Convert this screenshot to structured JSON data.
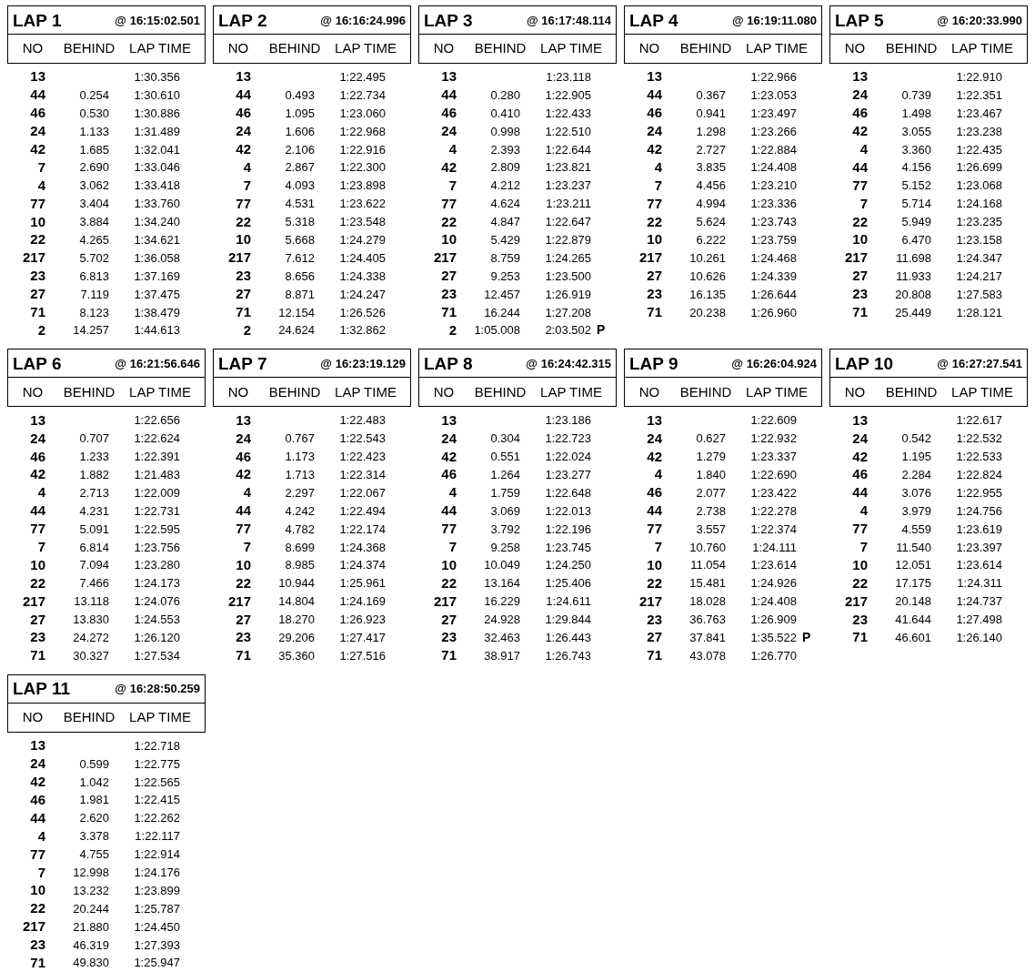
{
  "laps": [
    {
      "title": "LAP 1",
      "time": "@ 16:15:02.501",
      "columns": [
        "NO",
        "BEHIND",
        "LAP TIME"
      ],
      "rows": [
        {
          "no": "13",
          "lap_time": "1:30.356"
        },
        {
          "no": "44",
          "behind": "0.254",
          "lap_time": "1:30.610"
        },
        {
          "no": "46",
          "behind": "0.530",
          "lap_time": "1:30.886"
        },
        {
          "no": "24",
          "behind": "1.133",
          "lap_time": "1:31.489"
        },
        {
          "no": "42",
          "behind": "1.685",
          "lap_time": "1:32.041"
        },
        {
          "no": "7",
          "behind": "2.690",
          "lap_time": "1:33.046"
        },
        {
          "no": "4",
          "behind": "3.062",
          "lap_time": "1:33.418"
        },
        {
          "no": "77",
          "behind": "3.404",
          "lap_time": "1:33.760"
        },
        {
          "no": "10",
          "behind": "3.884",
          "lap_time": "1:34.240"
        },
        {
          "no": "22",
          "behind": "4.265",
          "lap_time": "1:34.621"
        },
        {
          "no": "217",
          "behind": "5.702",
          "lap_time": "1:36.058"
        },
        {
          "no": "23",
          "behind": "6.813",
          "lap_time": "1:37.169"
        },
        {
          "no": "27",
          "behind": "7.119",
          "lap_time": "1:37.475"
        },
        {
          "no": "71",
          "behind": "8.123",
          "lap_time": "1:38.479"
        },
        {
          "no": "2",
          "behind": "14.257",
          "lap_time": "1:44.613"
        }
      ]
    },
    {
      "title": "LAP 2",
      "time": "@ 16:16:24.996",
      "columns": [
        "NO",
        "BEHIND",
        "LAP TIME"
      ],
      "rows": [
        {
          "no": "13",
          "lap_time": "1:22.495"
        },
        {
          "no": "44",
          "behind": "0.493",
          "lap_time": "1:22.734"
        },
        {
          "no": "46",
          "behind": "1.095",
          "lap_time": "1:23.060"
        },
        {
          "no": "24",
          "behind": "1.606",
          "lap_time": "1:22.968"
        },
        {
          "no": "42",
          "behind": "2.106",
          "lap_time": "1:22.916"
        },
        {
          "no": "4",
          "behind": "2.867",
          "lap_time": "1:22.300"
        },
        {
          "no": "7",
          "behind": "4.093",
          "lap_time": "1:23.898"
        },
        {
          "no": "77",
          "behind": "4.531",
          "lap_time": "1:23.622"
        },
        {
          "no": "22",
          "behind": "5.318",
          "lap_time": "1:23.548"
        },
        {
          "no": "10",
          "behind": "5.668",
          "lap_time": "1:24.279"
        },
        {
          "no": "217",
          "behind": "7.612",
          "lap_time": "1:24.405"
        },
        {
          "no": "23",
          "behind": "8.656",
          "lap_time": "1:24.338"
        },
        {
          "no": "27",
          "behind": "8.871",
          "lap_time": "1:24.247"
        },
        {
          "no": "71",
          "behind": "12.154",
          "lap_time": "1:26.526"
        },
        {
          "no": "2",
          "behind": "24.624",
          "lap_time": "1:32.862"
        }
      ]
    },
    {
      "title": "LAP 3",
      "time": "@ 16:17:48.114",
      "columns": [
        "NO",
        "BEHIND",
        "LAP TIME"
      ],
      "rows": [
        {
          "no": "13",
          "lap_time": "1:23.118"
        },
        {
          "no": "44",
          "behind": "0.280",
          "lap_time": "1:22.905"
        },
        {
          "no": "46",
          "behind": "0.410",
          "lap_time": "1:22.433"
        },
        {
          "no": "24",
          "behind": "0.998",
          "lap_time": "1:22.510"
        },
        {
          "no": "4",
          "behind": "2.393",
          "lap_time": "1:22.644"
        },
        {
          "no": "42",
          "behind": "2.809",
          "lap_time": "1:23.821"
        },
        {
          "no": "7",
          "behind": "4.212",
          "lap_time": "1:23.237"
        },
        {
          "no": "77",
          "behind": "4.624",
          "lap_time": "1:23.211"
        },
        {
          "no": "22",
          "behind": "4.847",
          "lap_time": "1:22.647"
        },
        {
          "no": "10",
          "behind": "5.429",
          "lap_time": "1:22.879"
        },
        {
          "no": "217",
          "behind": "8.759",
          "lap_time": "1:24.265"
        },
        {
          "no": "27",
          "behind": "9.253",
          "lap_time": "1:23.500"
        },
        {
          "no": "23",
          "behind": "12.457",
          "lap_time": "1:26.919"
        },
        {
          "no": "71",
          "behind": "16.244",
          "lap_time": "1:27.208"
        },
        {
          "no": "2",
          "behind": "1:05.008",
          "lap_time": "2:03.502",
          "flag": "P"
        }
      ]
    },
    {
      "title": "LAP 4",
      "time": "@ 16:19:11.080",
      "columns": [
        "NO",
        "BEHIND",
        "LAP TIME"
      ],
      "rows": [
        {
          "no": "13",
          "lap_time": "1:22.966"
        },
        {
          "no": "44",
          "behind": "0.367",
          "lap_time": "1:23.053"
        },
        {
          "no": "46",
          "behind": "0.941",
          "lap_time": "1:23.497"
        },
        {
          "no": "24",
          "behind": "1.298",
          "lap_time": "1:23.266"
        },
        {
          "no": "42",
          "behind": "2.727",
          "lap_time": "1:22.884"
        },
        {
          "no": "4",
          "behind": "3.835",
          "lap_time": "1:24.408"
        },
        {
          "no": "7",
          "behind": "4.456",
          "lap_time": "1:23.210"
        },
        {
          "no": "77",
          "behind": "4.994",
          "lap_time": "1:23.336"
        },
        {
          "no": "22",
          "behind": "5.624",
          "lap_time": "1:23.743"
        },
        {
          "no": "10",
          "behind": "6.222",
          "lap_time": "1:23.759"
        },
        {
          "no": "217",
          "behind": "10.261",
          "lap_time": "1:24.468"
        },
        {
          "no": "27",
          "behind": "10.626",
          "lap_time": "1:24.339"
        },
        {
          "no": "23",
          "behind": "16.135",
          "lap_time": "1:26.644"
        },
        {
          "no": "71",
          "behind": "20.238",
          "lap_time": "1:26.960"
        }
      ]
    },
    {
      "title": "LAP 5",
      "time": "@ 16:20:33.990",
      "columns": [
        "NO",
        "BEHIND",
        "LAP TIME"
      ],
      "rows": [
        {
          "no": "13",
          "lap_time": "1:22.910"
        },
        {
          "no": "24",
          "behind": "0.739",
          "lap_time": "1:22.351"
        },
        {
          "no": "46",
          "behind": "1.498",
          "lap_time": "1:23.467"
        },
        {
          "no": "42",
          "behind": "3.055",
          "lap_time": "1:23.238"
        },
        {
          "no": "4",
          "behind": "3.360",
          "lap_time": "1:22.435"
        },
        {
          "no": "44",
          "behind": "4.156",
          "lap_time": "1:26.699"
        },
        {
          "no": "77",
          "behind": "5.152",
          "lap_time": "1:23.068"
        },
        {
          "no": "7",
          "behind": "5.714",
          "lap_time": "1:24.168"
        },
        {
          "no": "22",
          "behind": "5.949",
          "lap_time": "1:23.235"
        },
        {
          "no": "10",
          "behind": "6.470",
          "lap_time": "1:23.158"
        },
        {
          "no": "217",
          "behind": "11.698",
          "lap_time": "1:24.347"
        },
        {
          "no": "27",
          "behind": "11.933",
          "lap_time": "1:24.217"
        },
        {
          "no": "23",
          "behind": "20.808",
          "lap_time": "1:27.583"
        },
        {
          "no": "71",
          "behind": "25.449",
          "lap_time": "1:28.121"
        }
      ]
    },
    {
      "title": "LAP 6",
      "time": "@ 16:21:56.646",
      "columns": [
        "NO",
        "BEHIND",
        "LAP TIME"
      ],
      "rows": [
        {
          "no": "13",
          "lap_time": "1:22.656"
        },
        {
          "no": "24",
          "behind": "0.707",
          "lap_time": "1:22.624"
        },
        {
          "no": "46",
          "behind": "1.233",
          "lap_time": "1:22.391"
        },
        {
          "no": "42",
          "behind": "1.882",
          "lap_time": "1:21.483"
        },
        {
          "no": "4",
          "behind": "2.713",
          "lap_time": "1:22.009"
        },
        {
          "no": "44",
          "behind": "4.231",
          "lap_time": "1:22.731"
        },
        {
          "no": "77",
          "behind": "5.091",
          "lap_time": "1:22.595"
        },
        {
          "no": "7",
          "behind": "6.814",
          "lap_time": "1:23.756"
        },
        {
          "no": "10",
          "behind": "7.094",
          "lap_time": "1:23.280"
        },
        {
          "no": "22",
          "behind": "7.466",
          "lap_time": "1:24.173"
        },
        {
          "no": "217",
          "behind": "13.118",
          "lap_time": "1:24.076"
        },
        {
          "no": "27",
          "behind": "13.830",
          "lap_time": "1:24.553"
        },
        {
          "no": "23",
          "behind": "24.272",
          "lap_time": "1:26.120"
        },
        {
          "no": "71",
          "behind": "30.327",
          "lap_time": "1:27.534"
        }
      ]
    },
    {
      "title": "LAP 7",
      "time": "@ 16:23:19.129",
      "columns": [
        "NO",
        "BEHIND",
        "LAP TIME"
      ],
      "rows": [
        {
          "no": "13",
          "lap_time": "1:22.483"
        },
        {
          "no": "24",
          "behind": "0.767",
          "lap_time": "1:22.543"
        },
        {
          "no": "46",
          "behind": "1.173",
          "lap_time": "1:22.423"
        },
        {
          "no": "42",
          "behind": "1.713",
          "lap_time": "1:22.314"
        },
        {
          "no": "4",
          "behind": "2.297",
          "lap_time": "1:22.067"
        },
        {
          "no": "44",
          "behind": "4.242",
          "lap_time": "1:22.494"
        },
        {
          "no": "77",
          "behind": "4.782",
          "lap_time": "1:22.174"
        },
        {
          "no": "7",
          "behind": "8.699",
          "lap_time": "1:24.368"
        },
        {
          "no": "10",
          "behind": "8.985",
          "lap_time": "1:24.374"
        },
        {
          "no": "22",
          "behind": "10.944",
          "lap_time": "1:25.961"
        },
        {
          "no": "217",
          "behind": "14.804",
          "lap_time": "1:24.169"
        },
        {
          "no": "27",
          "behind": "18.270",
          "lap_time": "1:26.923"
        },
        {
          "no": "23",
          "behind": "29.206",
          "lap_time": "1:27.417"
        },
        {
          "no": "71",
          "behind": "35.360",
          "lap_time": "1:27.516"
        }
      ]
    },
    {
      "title": "LAP 8",
      "time": "@ 16:24:42.315",
      "columns": [
        "NO",
        "BEHIND",
        "LAP TIME"
      ],
      "rows": [
        {
          "no": "13",
          "lap_time": "1:23.186"
        },
        {
          "no": "24",
          "behind": "0.304",
          "lap_time": "1:22.723"
        },
        {
          "no": "42",
          "behind": "0.551",
          "lap_time": "1:22.024"
        },
        {
          "no": "46",
          "behind": "1.264",
          "lap_time": "1:23.277"
        },
        {
          "no": "4",
          "behind": "1.759",
          "lap_time": "1:22.648"
        },
        {
          "no": "44",
          "behind": "3.069",
          "lap_time": "1:22.013"
        },
        {
          "no": "77",
          "behind": "3.792",
          "lap_time": "1:22.196"
        },
        {
          "no": "7",
          "behind": "9.258",
          "lap_time": "1:23.745"
        },
        {
          "no": "10",
          "behind": "10.049",
          "lap_time": "1:24.250"
        },
        {
          "no": "22",
          "behind": "13.164",
          "lap_time": "1:25.406"
        },
        {
          "no": "217",
          "behind": "16.229",
          "lap_time": "1:24.611"
        },
        {
          "no": "27",
          "behind": "24.928",
          "lap_time": "1:29.844"
        },
        {
          "no": "23",
          "behind": "32.463",
          "lap_time": "1:26.443"
        },
        {
          "no": "71",
          "behind": "38.917",
          "lap_time": "1:26.743"
        }
      ]
    },
    {
      "title": "LAP 9",
      "time": "@ 16:26:04.924",
      "columns": [
        "NO",
        "BEHIND",
        "LAP TIME"
      ],
      "rows": [
        {
          "no": "13",
          "lap_time": "1:22.609"
        },
        {
          "no": "24",
          "behind": "0.627",
          "lap_time": "1:22.932"
        },
        {
          "no": "42",
          "behind": "1.279",
          "lap_time": "1:23.337"
        },
        {
          "no": "4",
          "behind": "1.840",
          "lap_time": "1:22.690"
        },
        {
          "no": "46",
          "behind": "2.077",
          "lap_time": "1:23.422"
        },
        {
          "no": "44",
          "behind": "2.738",
          "lap_time": "1:22.278"
        },
        {
          "no": "77",
          "behind": "3.557",
          "lap_time": "1:22.374"
        },
        {
          "no": "7",
          "behind": "10.760",
          "lap_time": "1:24.111"
        },
        {
          "no": "10",
          "behind": "11.054",
          "lap_time": "1:23.614"
        },
        {
          "no": "22",
          "behind": "15.481",
          "lap_time": "1:24.926"
        },
        {
          "no": "217",
          "behind": "18.028",
          "lap_time": "1:24.408"
        },
        {
          "no": "23",
          "behind": "36.763",
          "lap_time": "1:26.909"
        },
        {
          "no": "27",
          "behind": "37.841",
          "lap_time": "1:35.522",
          "flag": "P"
        },
        {
          "no": "71",
          "behind": "43.078",
          "lap_time": "1:26.770"
        }
      ]
    },
    {
      "title": "LAP 10",
      "time": "@ 16:27:27.541",
      "columns": [
        "NO",
        "BEHIND",
        "LAP TIME"
      ],
      "rows": [
        {
          "no": "13",
          "lap_time": "1:22.617"
        },
        {
          "no": "24",
          "behind": "0.542",
          "lap_time": "1:22.532"
        },
        {
          "no": "42",
          "behind": "1.195",
          "lap_time": "1:22.533"
        },
        {
          "no": "46",
          "behind": "2.284",
          "lap_time": "1:22.824"
        },
        {
          "no": "44",
          "behind": "3.076",
          "lap_time": "1:22.955"
        },
        {
          "no": "4",
          "behind": "3.979",
          "lap_time": "1:24.756"
        },
        {
          "no": "77",
          "behind": "4.559",
          "lap_time": "1:23.619"
        },
        {
          "no": "7",
          "behind": "11.540",
          "lap_time": "1:23.397"
        },
        {
          "no": "10",
          "behind": "12.051",
          "lap_time": "1:23.614"
        },
        {
          "no": "22",
          "behind": "17.175",
          "lap_time": "1:24.311"
        },
        {
          "no": "217",
          "behind": "20.148",
          "lap_time": "1:24.737"
        },
        {
          "no": "23",
          "behind": "41.644",
          "lap_time": "1:27.498"
        },
        {
          "no": "71",
          "behind": "46.601",
          "lap_time": "1:26.140"
        }
      ]
    },
    {
      "title": "LAP 11",
      "time": "@ 16:28:50.259",
      "columns": [
        "NO",
        "BEHIND",
        "LAP TIME"
      ],
      "rows": [
        {
          "no": "13",
          "lap_time": "1:22.718"
        },
        {
          "no": "24",
          "behind": "0.599",
          "lap_time": "1:22.775"
        },
        {
          "no": "42",
          "behind": "1.042",
          "lap_time": "1:22.565"
        },
        {
          "no": "46",
          "behind": "1.981",
          "lap_time": "1:22.415"
        },
        {
          "no": "44",
          "behind": "2.620",
          "lap_time": "1:22.262"
        },
        {
          "no": "4",
          "behind": "3.378",
          "lap_time": "1:22.117"
        },
        {
          "no": "77",
          "behind": "4.755",
          "lap_time": "1:22.914"
        },
        {
          "no": "7",
          "behind": "12.998",
          "lap_time": "1:24.176"
        },
        {
          "no": "10",
          "behind": "13.232",
          "lap_time": "1:23.899"
        },
        {
          "no": "22",
          "behind": "20.244",
          "lap_time": "1:25.787"
        },
        {
          "no": "217",
          "behind": "21.880",
          "lap_time": "1:24.450"
        },
        {
          "no": "23",
          "behind": "46.319",
          "lap_time": "1:27.393"
        },
        {
          "no": "71",
          "behind": "49.830",
          "lap_time": "1:25.947"
        }
      ]
    }
  ]
}
